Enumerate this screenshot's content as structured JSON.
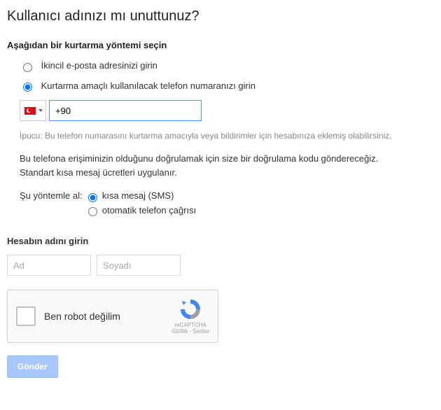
{
  "title": "Kullanıcı adınızı mı unuttunuz?",
  "subhead": "Aşağıdan bir kurtarma yöntemi seçin",
  "recovery": {
    "emailOption": "İkincil e-posta adresinizi girin",
    "phoneOption": "Kurtarma amaçlı kullanılacak telefon numaranızı girin"
  },
  "phone": {
    "value": "+90 ",
    "hint": "İpucu: Bu telefon numarasını kurtarma amacıyla veya bildirimler için hesabınıza eklemiş olabilirsiniz."
  },
  "verify": {
    "line1": "Bu telefona erişiminizin olduğunu doğrulamak için size bir doğrulama kodu göndereceğiz.",
    "line2": "Standart kısa mesaj ücretleri uygulanır."
  },
  "method": {
    "label": "Şu yöntemle al:",
    "sms": "kısa mesaj (SMS)",
    "call": "otomatik telefon çağrısı"
  },
  "account": {
    "title": "Hesabın adını girin",
    "firstPlaceholder": "Ad",
    "lastPlaceholder": "Soyadı"
  },
  "recaptcha": {
    "label": "Ben robot değilim",
    "brand": "reCAPTCHA",
    "terms": "Gizlilik - Şartlar"
  },
  "submit": "Gönder"
}
